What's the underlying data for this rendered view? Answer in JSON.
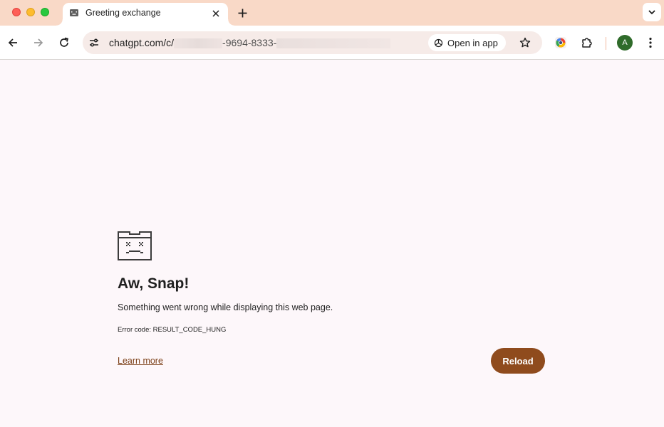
{
  "tab": {
    "title": "Greeting exchange",
    "favicon": "sad-page-icon"
  },
  "address_bar": {
    "host": "chatgpt.com/c/",
    "visible_fragment": "-9694-8333-",
    "open_in_app_label": "Open in app"
  },
  "profile": {
    "initial": "A"
  },
  "error_page": {
    "heading": "Aw, Snap!",
    "message": "Something went wrong while displaying this web page.",
    "error_code": "Error code: RESULT_CODE_HUNG",
    "learn_more_label": "Learn more",
    "reload_label": "Reload"
  },
  "colors": {
    "tab_strip": "#f9d9c7",
    "page_background": "#fdf7fa",
    "accent": "#8f4b1d",
    "avatar": "#2f6b2a"
  }
}
